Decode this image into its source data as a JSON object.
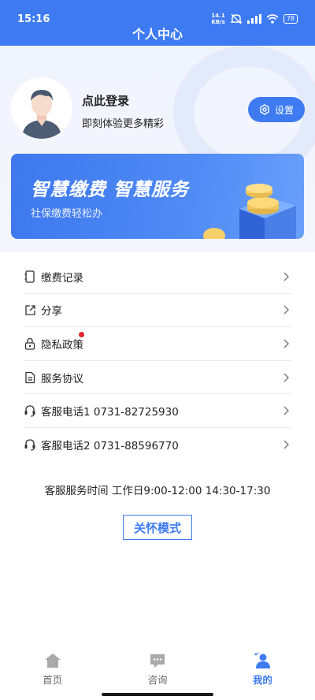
{
  "status_bar": {
    "time": "15:16",
    "net_speed_value": "14.1",
    "net_speed_unit": "KB/s",
    "battery": "78"
  },
  "header": {
    "title": "个人中心"
  },
  "profile": {
    "login_title": "点此登录",
    "login_subtitle": "即刻体验更多精彩",
    "settings_label": "设置"
  },
  "banner": {
    "title": "智慧缴费 智慧服务",
    "subtitle": "社保缴费轻松办"
  },
  "menu": {
    "items": [
      {
        "label": "缴费记录",
        "icon": "payment-record-icon"
      },
      {
        "label": "分享",
        "icon": "share-icon"
      },
      {
        "label": "隐私政策",
        "icon": "lock-icon",
        "badge": true
      },
      {
        "label": "服务协议",
        "icon": "document-icon"
      },
      {
        "label": "客服电话1 0731-82725930",
        "icon": "headset-icon"
      },
      {
        "label": "客服电话2 0731-88596770",
        "icon": "headset-icon"
      }
    ]
  },
  "service_hours": "客服服务时间 工作日9:00-12:00 14:30-17:30",
  "care_mode_label": "关怀模式",
  "tabbar": {
    "tabs": [
      {
        "label": "首页",
        "icon": "home-icon",
        "active": false
      },
      {
        "label": "咨询",
        "icon": "chat-icon",
        "active": false
      },
      {
        "label": "我的",
        "icon": "user-icon",
        "active": true
      }
    ]
  },
  "colors": {
    "primary": "#3e7bf2",
    "badge": "#e0242f"
  }
}
